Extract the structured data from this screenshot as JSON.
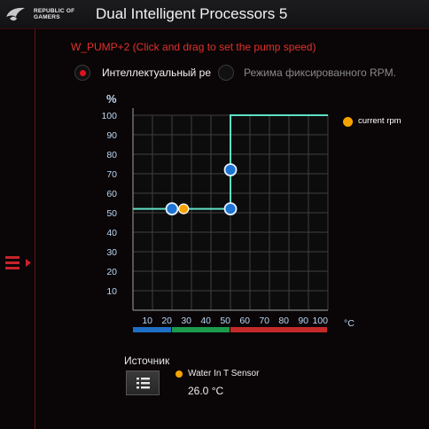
{
  "app": {
    "brand_line1": "REPUBLIC OF",
    "brand_line2": "GAMERS",
    "title": "Dual Intelligent Processors 5"
  },
  "pump": {
    "title": "W_PUMP+2 (Click and drag to set the pump speed)"
  },
  "modes": {
    "smart_label": "Интеллектуальный ре",
    "fixed_label": "Режима фиксированного RPM.",
    "selected": "smart"
  },
  "chart_data": {
    "type": "line",
    "ylabel": "%",
    "xlabel": "°C",
    "xlim": [
      0,
      100
    ],
    "ylim": [
      0,
      100
    ],
    "x_ticks": [
      10,
      20,
      30,
      40,
      50,
      60,
      70,
      80,
      90,
      100
    ],
    "y_ticks": [
      10,
      20,
      30,
      40,
      50,
      60,
      70,
      80,
      90,
      100
    ],
    "grid": true,
    "series": [
      {
        "color": "#5fe0c4",
        "points": [
          [
            0,
            52
          ],
          [
            20,
            52
          ],
          [
            50,
            52
          ],
          [
            50,
            72
          ],
          [
            50,
            100
          ],
          [
            100,
            100
          ]
        ]
      }
    ],
    "control_points": [
      [
        20,
        52
      ],
      [
        50,
        52
      ],
      [
        50,
        72
      ]
    ],
    "current_rpm_point": [
      26,
      52
    ],
    "current_rpm_label": "current rpm",
    "temperature_bands": [
      {
        "from": 0,
        "to": 20,
        "color": "#1f6fc4"
      },
      {
        "from": 20,
        "to": 50,
        "color": "#1c9a4c"
      },
      {
        "from": 50,
        "to": 100,
        "color": "#c42a2a"
      }
    ]
  },
  "source": {
    "label": "Источник",
    "sensor_name": "Water In T Sensor",
    "sensor_value": "26.0 °C"
  },
  "colors": {
    "accent": "#e0121c",
    "curve": "#5fe0c4",
    "node": "#1e74d4",
    "current": "#f5a300"
  }
}
